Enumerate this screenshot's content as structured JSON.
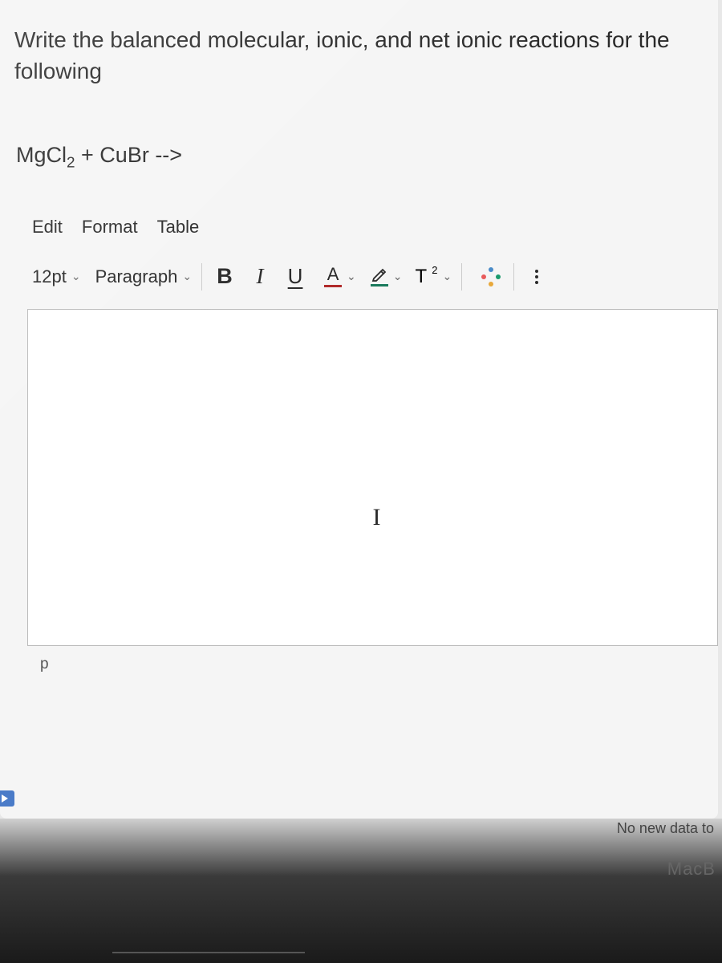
{
  "question": {
    "prompt": "Write the balanced molecular, ionic, and net ionic reactions for the following",
    "formula_prefix": "MgCl",
    "formula_sub": "2",
    "formula_rest": " + CuBr -->"
  },
  "menu": {
    "edit": "Edit",
    "format": "Format",
    "table": "Table"
  },
  "toolbar": {
    "font_size": "12pt",
    "paragraph": "Paragraph",
    "bold": "B",
    "italic": "I",
    "underline": "U",
    "text_color_letter": "A",
    "superscript_base": "T",
    "superscript_sup": "2"
  },
  "editor": {
    "cursor": "I"
  },
  "status": {
    "element_path": "p",
    "save_message": "No new data to ",
    "device": "MacB"
  }
}
